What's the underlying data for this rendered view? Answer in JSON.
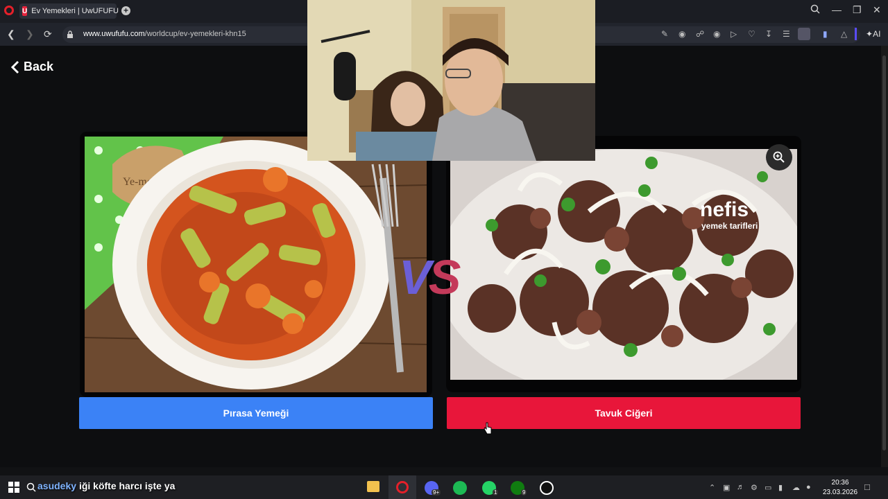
{
  "browser": {
    "tab_title": "Ev Yemekleri | UwUFUFU",
    "tab_favicon_letter": "U",
    "url_domain": "www.uwufufu.com",
    "url_path": "/worldcup/ev-yemekleri-khn15",
    "ai_label": "AI"
  },
  "page": {
    "back_label": "Back",
    "vs_left": "V",
    "vs_right": "S",
    "left_choice": "Pırasa Yemeği",
    "right_choice": "Tavuk Ciğeri",
    "watermark_left": "Ye-mek.com",
    "watermark_right_brand": "nefis",
    "watermark_right_sub": "yemek tarifleri"
  },
  "taskbar": {
    "overlay_text": "iği köfte harcı işte ya",
    "overlay_prefix": "asudeky",
    "time": "20:36",
    "date": "23.03.2026",
    "whatsapp_badge": "1",
    "xbox_badge": "9",
    "discord_badge": "9+"
  },
  "colors": {
    "left_button": "#3b82f6",
    "right_button": "#e8163a",
    "opera_red": "#e4202a"
  }
}
